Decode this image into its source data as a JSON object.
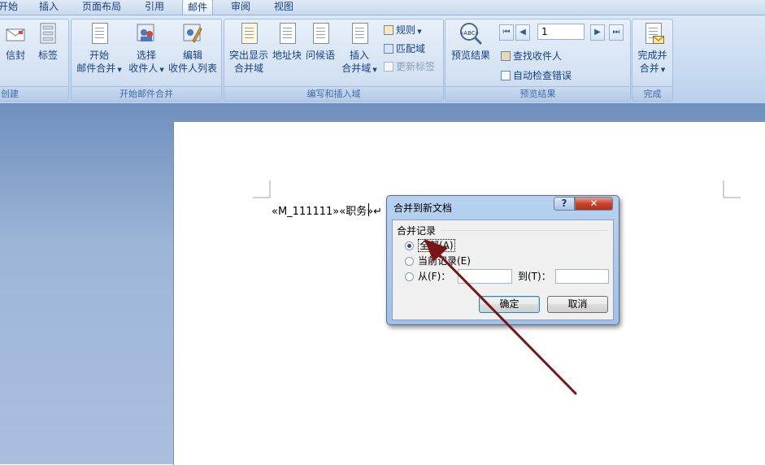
{
  "tabs": [
    {
      "label": "开始",
      "active": false
    },
    {
      "label": "插入",
      "active": false
    },
    {
      "label": "页面布局",
      "active": false
    },
    {
      "label": "引用",
      "active": false
    },
    {
      "label": "邮件",
      "active": true
    },
    {
      "label": "审阅",
      "active": false
    },
    {
      "label": "视图",
      "active": false
    }
  ],
  "ribbon": {
    "create": {
      "label": "创建",
      "envelope": "信封",
      "labels": "标签"
    },
    "start_merge": {
      "label": "开始邮件合并",
      "start_line1": "开始",
      "start_line2": "邮件合并",
      "select_line1": "选择",
      "select_line2": "收件人",
      "edit_line1": "编辑",
      "edit_line2": "收件人列表"
    },
    "write_insert": {
      "label": "编写和插入域",
      "highlight_line1": "突出显示",
      "highlight_line2": "合并域",
      "address_block": "地址块",
      "greeting": "问候语",
      "insert_line1": "插入",
      "insert_line2": "合并域",
      "rules": "规则",
      "match_fields": "匹配域",
      "update_labels": "更新标签"
    },
    "preview": {
      "label": "预览结果",
      "preview_results": "预览结果",
      "record": "1",
      "find_recipient": "查找收件人",
      "auto_check": "自动检查错误",
      "abc_badge": "«ABC»"
    },
    "finish": {
      "label": "完成",
      "finish_line1": "完成并",
      "finish_line2": "合并"
    }
  },
  "document": {
    "merge_text": "«M_111111»«职务»↵"
  },
  "dialog": {
    "title": "合并到新文档",
    "help_glyph": "?",
    "close_glyph": "✕",
    "group_label": "合并记录",
    "option_all": "全部(A)",
    "option_current": "当前记录(E)",
    "option_from": "从(F)：",
    "to_label": "到(T)：",
    "from_value": "",
    "to_value": "",
    "selected": "all",
    "ok": "确定",
    "cancel": "取消"
  },
  "colors": {
    "annotation_arrow": "#7a1515",
    "ribbon_text": "#15428b"
  }
}
